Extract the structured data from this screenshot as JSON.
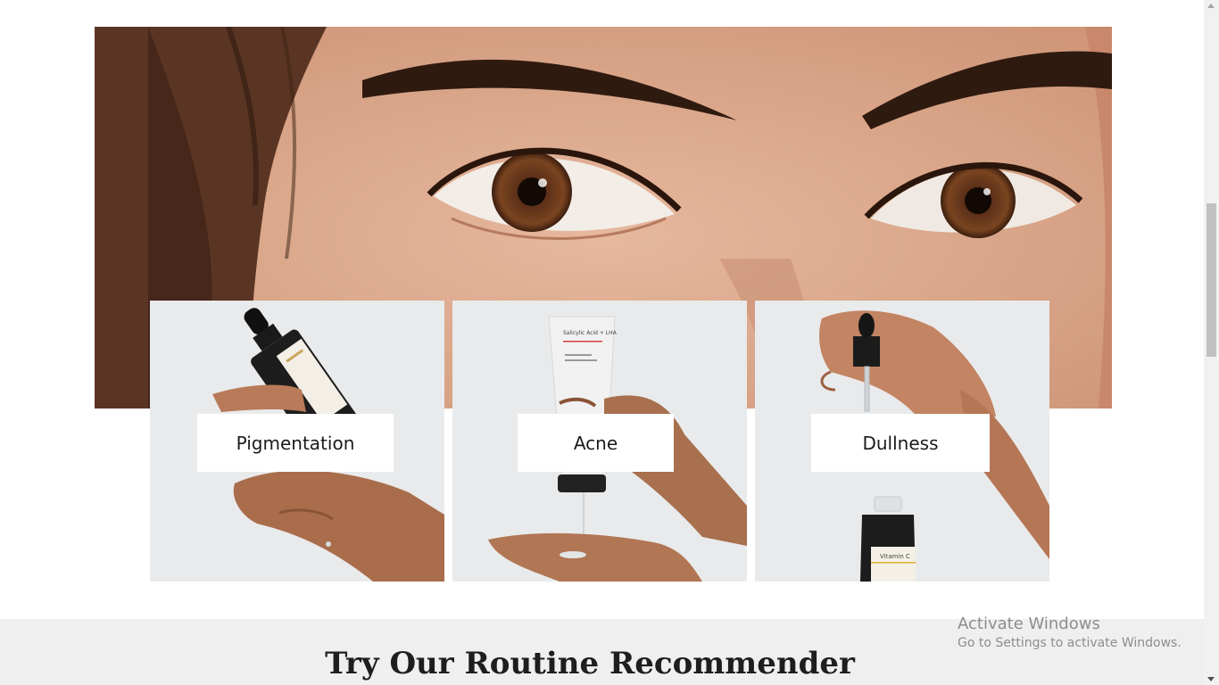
{
  "hero": {
    "image": "close-up of eyes and eyebrows"
  },
  "concerns": [
    {
      "label": "Pigmentation",
      "icon": "serum-dropper-bottle"
    },
    {
      "label": "Acne",
      "icon": "salicylic-cleanser-tube"
    },
    {
      "label": "Dullness",
      "icon": "vitamin-c-serum-dropper"
    }
  ],
  "products": {
    "cleanser_label": "Salicylic Acid + LHA",
    "serum_label": "Vitamin C"
  },
  "routine": {
    "title": "Try Our Routine Recommender"
  },
  "watermark": {
    "title": "Activate Windows",
    "subtitle": "Go to Settings to activate Windows."
  },
  "colors": {
    "card_bg": "#e9eaeb",
    "section_bg": "#efefef",
    "text": "#1b1b1b"
  }
}
